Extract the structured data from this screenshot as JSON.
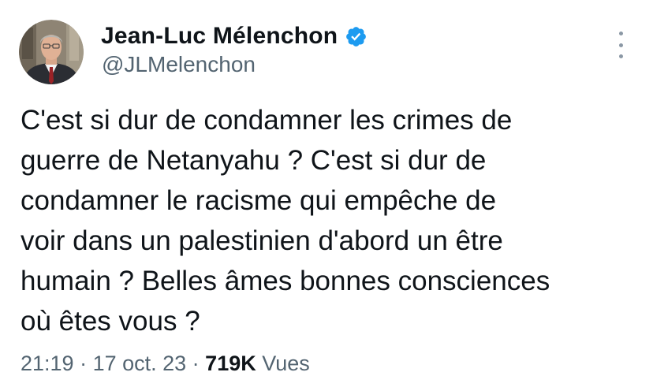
{
  "author": {
    "display_name": "Jean-Luc Mélenchon",
    "handle": "@JLMelenchon",
    "verified": true,
    "verified_color": "#1d9bf0"
  },
  "tweet": {
    "lines": [
      "C'est si dur de condamner les crimes de",
      "guerre de Netanyahu ? C'est si dur de",
      "condamner le racisme qui empêche de",
      "voir dans un palestinien d'abord un être",
      "humain ? Belles âmes bonnes consciences",
      "où êtes vous ?"
    ]
  },
  "meta": {
    "time": "21:19",
    "separator": " · ",
    "date": "17 oct. 23",
    "views_count": "719K",
    "views_label": "Vues"
  },
  "icons": {
    "avatar": "avatar",
    "verified": "verified-badge-icon",
    "more": "more-options-icon"
  }
}
